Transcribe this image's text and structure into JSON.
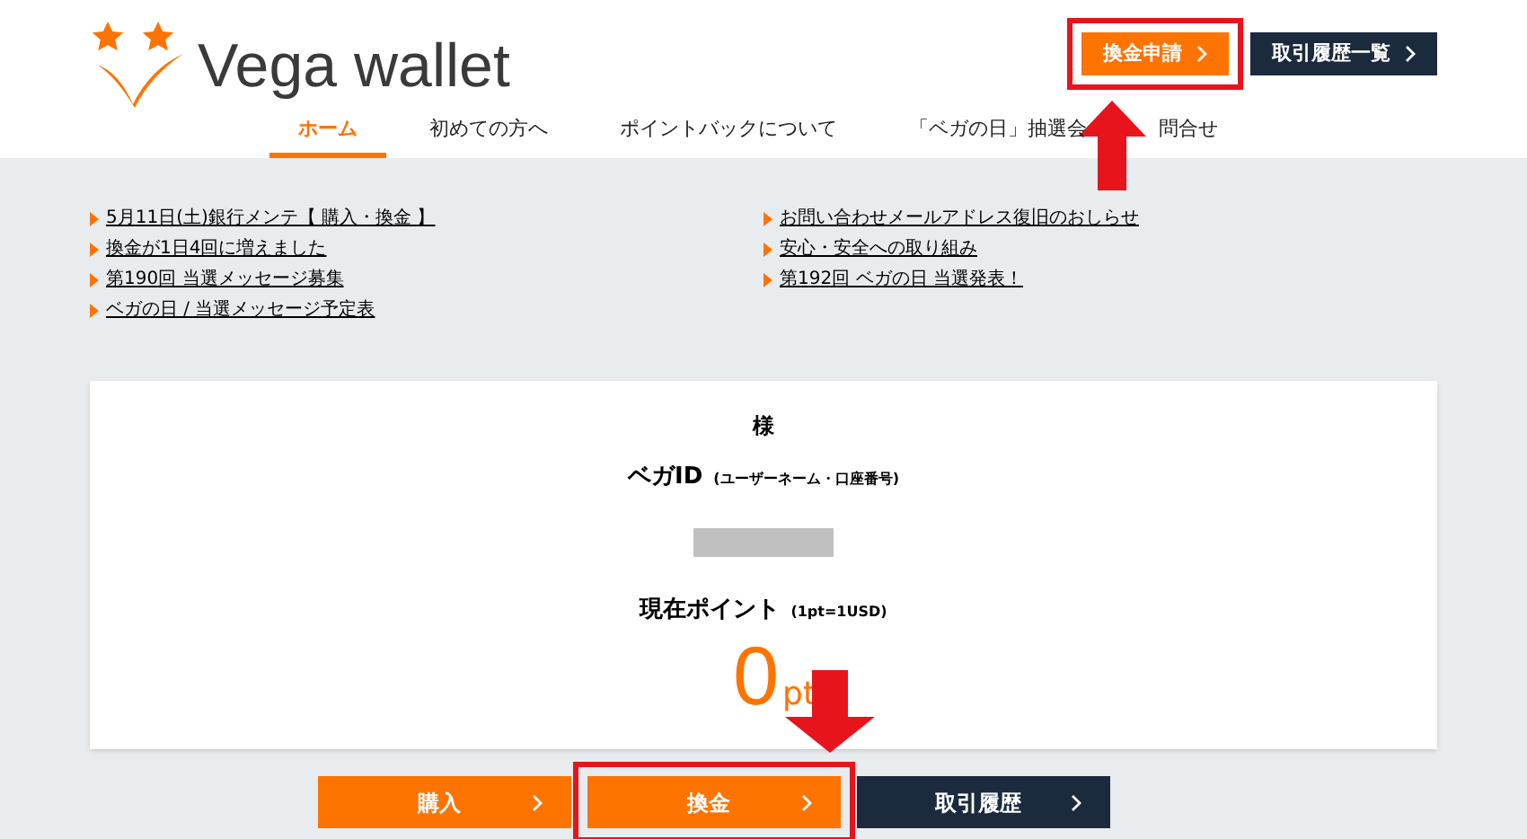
{
  "header": {
    "logo_text": "Vega wallet",
    "buttons": [
      {
        "label": "換金申請",
        "kind": "primary",
        "highlighted": true,
        "arrow": true
      },
      {
        "label": "取引履歴一覧",
        "kind": "dark",
        "highlighted": false,
        "arrow": false
      }
    ]
  },
  "nav": [
    {
      "label": "ホーム",
      "selected": true
    },
    {
      "label": "初めての方へ",
      "selected": false
    },
    {
      "label": "ポイントバックについて",
      "selected": false
    },
    {
      "label": "「ベガの日」抽選会",
      "selected": false
    },
    {
      "label": "問合せ",
      "selected": false
    }
  ],
  "news": {
    "left": [
      "5月11日(土)銀行メンテ【 購入・換金 】",
      "換金が1日4回に増えました",
      "第190回 当選メッセージ募集",
      "ベガの日 / 当選メッセージ予定表"
    ],
    "right": [
      "お問い合わせメールアドレス復旧のおしらせ",
      "安心・安全への取り組み",
      "第192回 ベガの日 当選発表！"
    ]
  },
  "account": {
    "honorific": "様",
    "id_label": "ベガID",
    "id_note": "(ユーザーネーム・口座番号)",
    "points_label": "現在ポイント",
    "points_note": "(1pt=1USD)",
    "points_value": "0",
    "points_unit": "pt"
  },
  "actions": [
    {
      "label": "購入",
      "kind": "primary",
      "highlighted": false,
      "arrow": false
    },
    {
      "label": "換金",
      "kind": "primary",
      "highlighted": true,
      "arrow": true
    },
    {
      "label": "取引履歴",
      "kind": "dark",
      "highlighted": false,
      "arrow": false
    }
  ]
}
